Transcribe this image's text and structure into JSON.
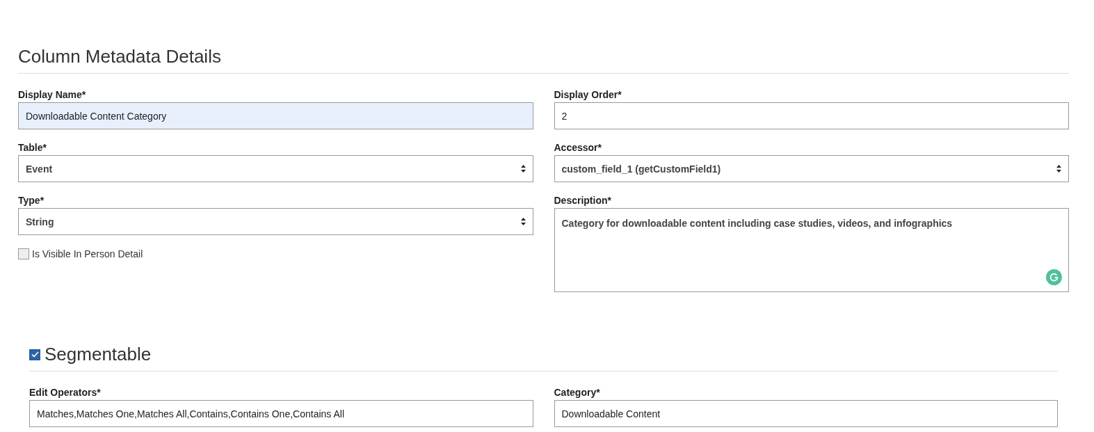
{
  "title": "Column Metadata Details",
  "columns": [
    {
      "fields": [
        {
          "kind": "input",
          "label": "Display Name*",
          "value": "Downloadable Content Category",
          "highlighted": true
        },
        {
          "kind": "select",
          "label": "Table*",
          "value": "Event"
        },
        {
          "kind": "select",
          "label": "Type*",
          "value": "String"
        },
        {
          "kind": "checkbox",
          "label": "Is Visible In Person Detail",
          "checked": false
        }
      ]
    },
    {
      "fields": [
        {
          "kind": "input",
          "label": "Display Order*",
          "value": "2",
          "highlighted": false
        },
        {
          "kind": "select",
          "label": "Accessor*",
          "value": "custom_field_1 (getCustomField1)"
        },
        {
          "kind": "textarea",
          "label": "Description*",
          "value": "Category for downloadable content including case studies, videos, and infographics"
        }
      ]
    }
  ],
  "segmentable": {
    "label": "Segmentable",
    "checked": true,
    "fields": [
      {
        "kind": "input",
        "label": "Edit Operators*",
        "value": "Matches,Matches One,Matches All,Contains,Contains One,Contains All",
        "highlighted": false
      },
      {
        "kind": "input",
        "label": "Category*",
        "value": "Downloadable Content",
        "highlighted": false
      }
    ]
  }
}
